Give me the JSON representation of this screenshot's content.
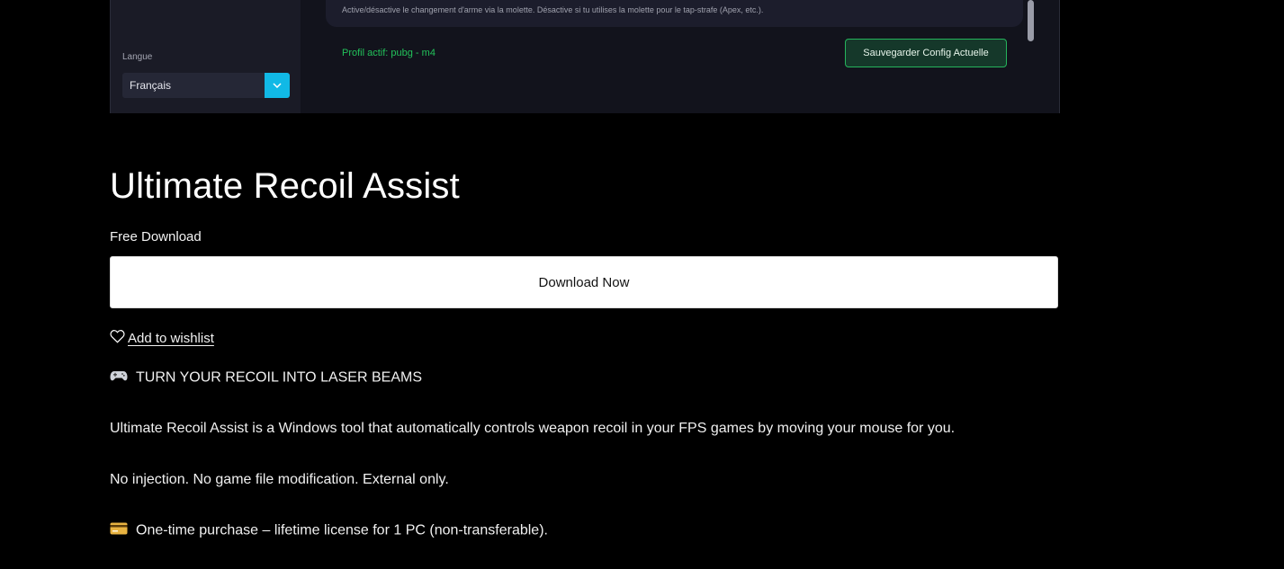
{
  "app_screenshot": {
    "language_label": "Langue",
    "language_value": "Français",
    "info_text": "Active/désactive le changement d'arme via la molette. Désactive si tu utilises la molette pour le tap-strafe (Apex, etc.).",
    "profile_active": "Profil actif: pubg - m4",
    "save_button": "Sauvegarder Config Actuelle",
    "colors": {
      "accent_cyan": "#11b9e6",
      "accent_green": "#22c25a"
    }
  },
  "product": {
    "title": "Ultimate Recoil Assist",
    "price_label": "Free Download",
    "download_button": "Download Now",
    "wishlist_label": "Add to wishlist"
  },
  "description": {
    "headline_icon": "gamepad-icon",
    "headline": "TURN YOUR RECOIL INTO LASER BEAMS",
    "paragraph_1": "Ultimate Recoil Assist is a Windows tool that automatically controls weapon recoil in your FPS games by moving your mouse for you.",
    "paragraph_2": "No injection. No game file modification. External only.",
    "license_icon": "credit-card-icon",
    "license_line": "One-time purchase – lifetime license for 1 PC (non-transferable)."
  }
}
